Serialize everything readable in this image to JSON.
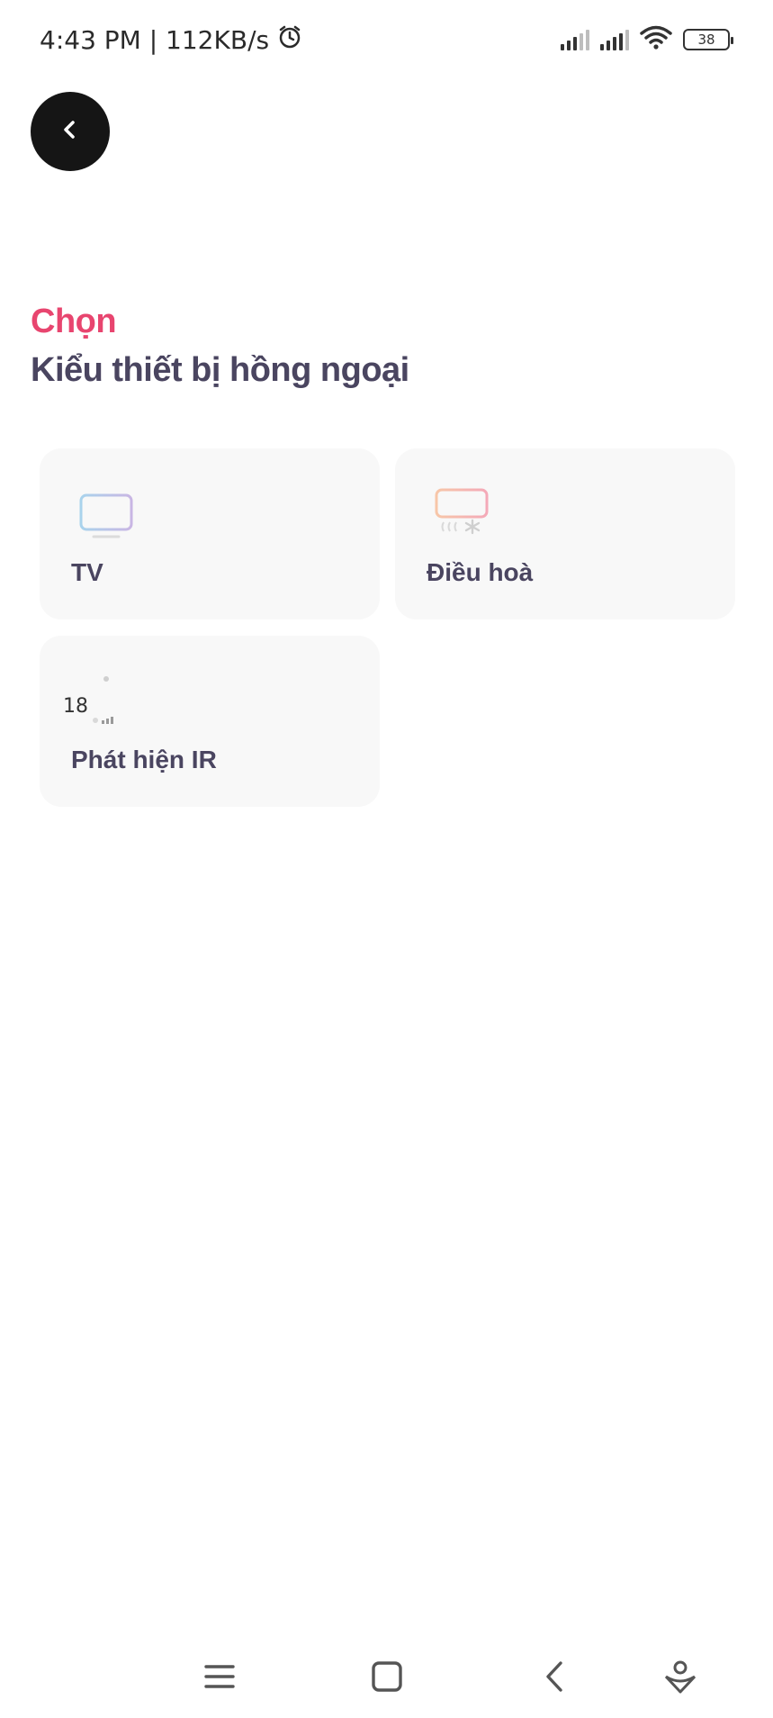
{
  "status_bar": {
    "time_speed": "4:43 PM | 112KB/s",
    "battery": "38",
    "icons": [
      "alarm-icon",
      "signal-icon",
      "signal-icon",
      "wifi-icon",
      "battery-icon"
    ]
  },
  "header": {
    "back_icon": "chevron-left-icon",
    "title_accent": "Chọn",
    "title": "Kiểu thiết bị hồng ngoại"
  },
  "devices": [
    {
      "label": "TV",
      "icon": "tv-icon"
    },
    {
      "label": "Điều hoà",
      "icon": "air-conditioner-icon"
    },
    {
      "label": "Phát hiện IR",
      "icon": "ir-detect-icon",
      "display_value": "18"
    }
  ],
  "nav_bar": {
    "icons": [
      "menu-icon",
      "home-square-icon",
      "back-icon",
      "assistant-icon"
    ]
  },
  "colors": {
    "accent": "#e8456f",
    "heading": "#4a4560",
    "card_bg": "#f8f8f8",
    "back_button": "#151515"
  }
}
